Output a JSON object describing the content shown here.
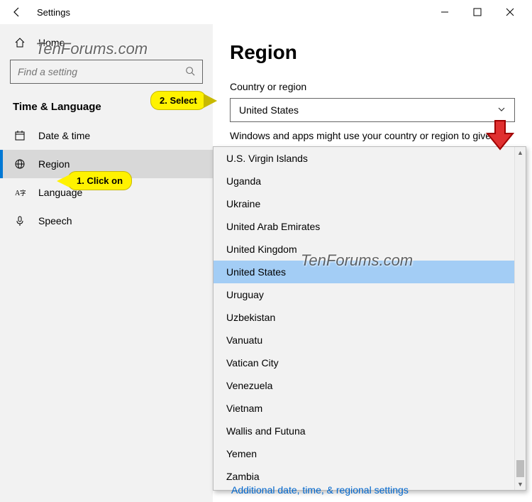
{
  "titlebar": {
    "title": "Settings"
  },
  "sidebar": {
    "home": "Home",
    "search_placeholder": "Find a setting",
    "section": "Time & Language",
    "items": [
      {
        "label": "Date & time"
      },
      {
        "label": "Region"
      },
      {
        "label": "Language"
      },
      {
        "label": "Speech"
      }
    ]
  },
  "main": {
    "title": "Region",
    "field_label": "Country or region",
    "selected": "United States",
    "description": "Windows and apps might use your country or region to give you local content."
  },
  "dropdown": {
    "options": [
      "U.S. Virgin Islands",
      "Uganda",
      "Ukraine",
      "United Arab Emirates",
      "United Kingdom",
      "United States",
      "Uruguay",
      "Uzbekistan",
      "Vanuatu",
      "Vatican City",
      "Venezuela",
      "Vietnam",
      "Wallis and Futuna",
      "Yemen",
      "Zambia"
    ],
    "selected_index": 5
  },
  "link": "Additional date, time, & regional settings",
  "annotations": {
    "callout1": "1. Click on",
    "callout2": "2. Select"
  },
  "watermark": "TenForums.com"
}
